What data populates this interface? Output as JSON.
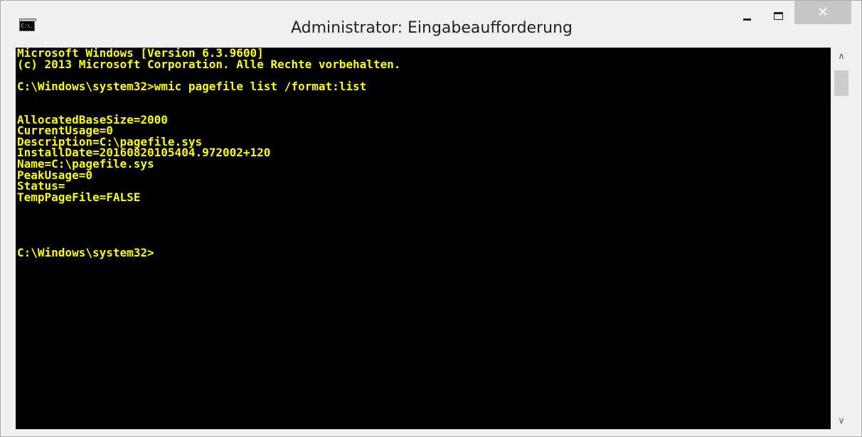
{
  "window": {
    "title": "Administrator: Eingabeaufforderung",
    "icon_label": "C:\\.",
    "minimize_glyph": "",
    "maximize_glyph": "",
    "close_glyph": "✕"
  },
  "console": {
    "foreground_color": "#ffff00",
    "background_color": "#000000",
    "lines": [
      "Microsoft Windows [Version 6.3.9600]",
      "(c) 2013 Microsoft Corporation. Alle Rechte vorbehalten.",
      "",
      "C:\\Windows\\system32>wmic pagefile list /format:list",
      "",
      "",
      "AllocatedBaseSize=2000",
      "CurrentUsage=0",
      "Description=C:\\pagefile.sys",
      "InstallDate=20160820105404.972002+120",
      "Name=C:\\pagefile.sys",
      "PeakUsage=0",
      "Status=",
      "TempPageFile=FALSE",
      "",
      "",
      "",
      "",
      "C:\\Windows\\system32>"
    ]
  },
  "scrollbar": {
    "up_glyph": "∧",
    "down_glyph": "∨"
  }
}
